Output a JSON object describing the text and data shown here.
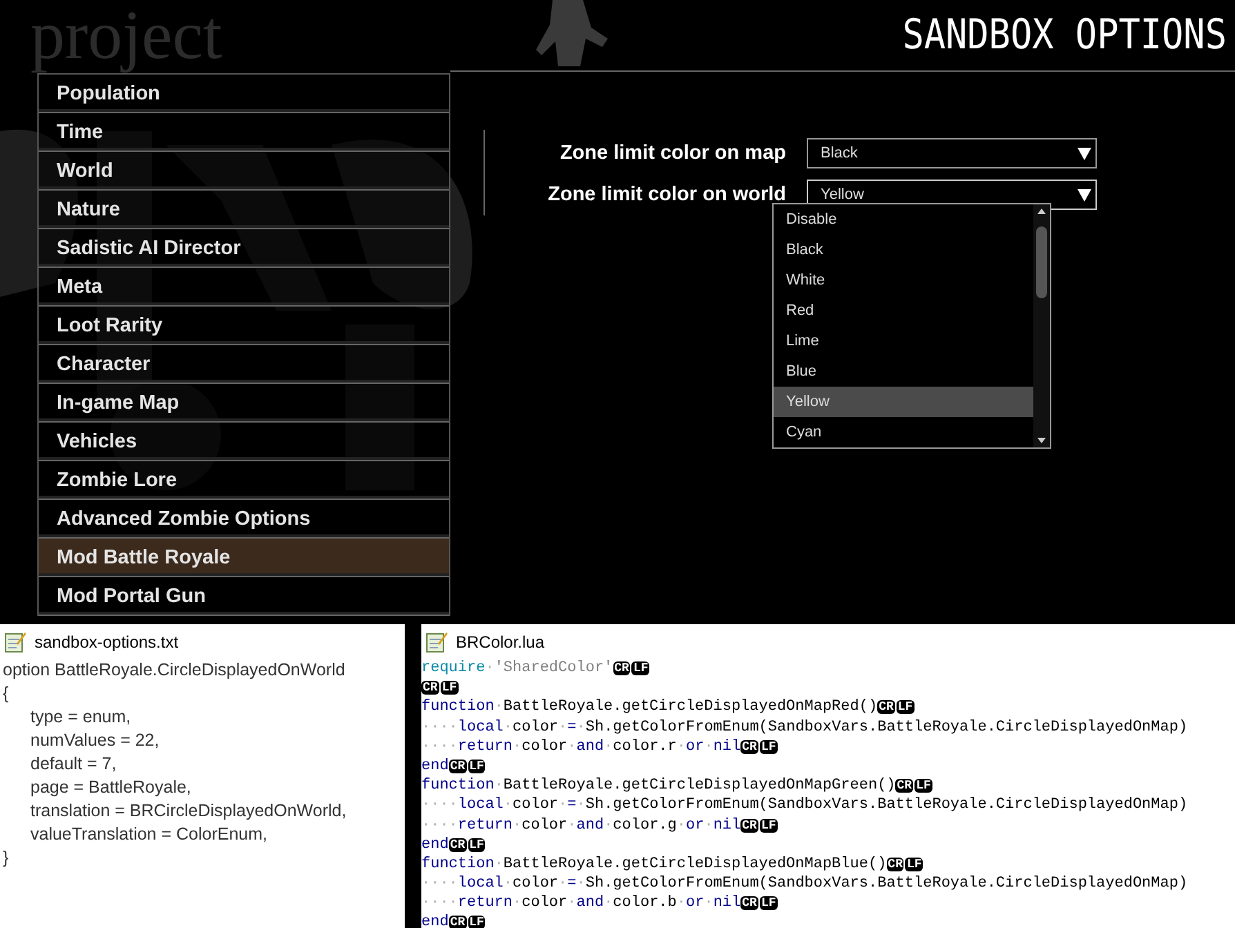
{
  "logo": {
    "text": "project"
  },
  "header": {
    "title": "SANDBOX OPTIONS"
  },
  "categories": [
    {
      "label": "Population",
      "selected": false
    },
    {
      "label": "Time",
      "selected": false
    },
    {
      "label": "World",
      "selected": false
    },
    {
      "label": "Nature",
      "selected": false
    },
    {
      "label": "Sadistic AI Director",
      "selected": false
    },
    {
      "label": "Meta",
      "selected": false
    },
    {
      "label": "Loot Rarity",
      "selected": false
    },
    {
      "label": "Character",
      "selected": false
    },
    {
      "label": "In-game Map",
      "selected": false
    },
    {
      "label": "Vehicles",
      "selected": false
    },
    {
      "label": "Zombie Lore",
      "selected": false
    },
    {
      "label": "Advanced Zombie Options",
      "selected": false
    },
    {
      "label": "Mod Battle Royale",
      "selected": true
    },
    {
      "label": "Mod Portal Gun",
      "selected": false
    }
  ],
  "settings": [
    {
      "label": "Zone limit color on map",
      "value": "Black",
      "expanded": false
    },
    {
      "label": "Zone limit color on world",
      "value": "Yellow",
      "expanded": true,
      "options": [
        {
          "label": "Disable",
          "selected": false
        },
        {
          "label": "Black",
          "selected": false
        },
        {
          "label": "White",
          "selected": false
        },
        {
          "label": "Red",
          "selected": false
        },
        {
          "label": "Lime",
          "selected": false
        },
        {
          "label": "Blue",
          "selected": false
        },
        {
          "label": "Yellow",
          "selected": true
        },
        {
          "label": "Cyan",
          "selected": false
        }
      ]
    }
  ],
  "text_file": {
    "title": "sandbox-options.txt",
    "header": "option BattleRoyale.CircleDisplayedOnWorld",
    "open": "{",
    "body": [
      "type = enum,",
      "numValues = 22,",
      "default = 7,",
      "page = BattleRoyale,",
      "translation = BRCircleDisplayedOnWorld,",
      "valueTranslation = ColorEnum,"
    ],
    "close": "}"
  },
  "code_file": {
    "title": "BRColor.lua",
    "lines": [
      [
        {
          "text": "require",
          "kind": "builtin"
        },
        {
          "text": "·",
          "kind": "ws"
        },
        {
          "text": "'SharedColor'",
          "kind": "str"
        },
        {
          "text": "CR",
          "kind": "eol"
        },
        {
          "text": "LF",
          "kind": "eol"
        }
      ],
      [
        {
          "text": "CR",
          "kind": "eol"
        },
        {
          "text": "LF",
          "kind": "eol"
        }
      ],
      [
        {
          "text": "function",
          "kind": "kw"
        },
        {
          "text": "·",
          "kind": "ws"
        },
        {
          "text": "BattleRoyale.getCircleDisplayedOnMapRed()",
          "kind": "id"
        },
        {
          "text": "CR",
          "kind": "eol"
        },
        {
          "text": "LF",
          "kind": "eol"
        }
      ],
      [
        {
          "text": "····",
          "kind": "ws"
        },
        {
          "text": "local",
          "kind": "kw"
        },
        {
          "text": "·",
          "kind": "ws"
        },
        {
          "text": "color",
          "kind": "id"
        },
        {
          "text": "·",
          "kind": "ws"
        },
        {
          "text": "=",
          "kind": "kw"
        },
        {
          "text": "·",
          "kind": "ws"
        },
        {
          "text": "Sh.getColorFromEnum(SandboxVars.BattleRoyale.CircleDisplayedOnMap)",
          "kind": "id"
        }
      ],
      [
        {
          "text": "····",
          "kind": "ws"
        },
        {
          "text": "return",
          "kind": "kw"
        },
        {
          "text": "·",
          "kind": "ws"
        },
        {
          "text": "color",
          "kind": "id"
        },
        {
          "text": "·",
          "kind": "ws"
        },
        {
          "text": "and",
          "kind": "kw"
        },
        {
          "text": "·",
          "kind": "ws"
        },
        {
          "text": "color.r",
          "kind": "id"
        },
        {
          "text": "·",
          "kind": "ws"
        },
        {
          "text": "or",
          "kind": "kw"
        },
        {
          "text": "·",
          "kind": "ws"
        },
        {
          "text": "nil",
          "kind": "kw"
        },
        {
          "text": "CR",
          "kind": "eol"
        },
        {
          "text": "LF",
          "kind": "eol"
        }
      ],
      [
        {
          "text": "end",
          "kind": "kw"
        },
        {
          "text": "CR",
          "kind": "eol"
        },
        {
          "text": "LF",
          "kind": "eol"
        }
      ],
      [
        {
          "text": "function",
          "kind": "kw"
        },
        {
          "text": "·",
          "kind": "ws"
        },
        {
          "text": "BattleRoyale.getCircleDisplayedOnMapGreen()",
          "kind": "id"
        },
        {
          "text": "CR",
          "kind": "eol"
        },
        {
          "text": "LF",
          "kind": "eol"
        }
      ],
      [
        {
          "text": "····",
          "kind": "ws"
        },
        {
          "text": "local",
          "kind": "kw"
        },
        {
          "text": "·",
          "kind": "ws"
        },
        {
          "text": "color",
          "kind": "id"
        },
        {
          "text": "·",
          "kind": "ws"
        },
        {
          "text": "=",
          "kind": "kw"
        },
        {
          "text": "·",
          "kind": "ws"
        },
        {
          "text": "Sh.getColorFromEnum(SandboxVars.BattleRoyale.CircleDisplayedOnMap)",
          "kind": "id"
        }
      ],
      [
        {
          "text": "····",
          "kind": "ws"
        },
        {
          "text": "return",
          "kind": "kw"
        },
        {
          "text": "·",
          "kind": "ws"
        },
        {
          "text": "color",
          "kind": "id"
        },
        {
          "text": "·",
          "kind": "ws"
        },
        {
          "text": "and",
          "kind": "kw"
        },
        {
          "text": "·",
          "kind": "ws"
        },
        {
          "text": "color.g",
          "kind": "id"
        },
        {
          "text": "·",
          "kind": "ws"
        },
        {
          "text": "or",
          "kind": "kw"
        },
        {
          "text": "·",
          "kind": "ws"
        },
        {
          "text": "nil",
          "kind": "kw"
        },
        {
          "text": "CR",
          "kind": "eol"
        },
        {
          "text": "LF",
          "kind": "eol"
        }
      ],
      [
        {
          "text": "end",
          "kind": "kw"
        },
        {
          "text": "CR",
          "kind": "eol"
        },
        {
          "text": "LF",
          "kind": "eol"
        }
      ],
      [
        {
          "text": "function",
          "kind": "kw"
        },
        {
          "text": "·",
          "kind": "ws"
        },
        {
          "text": "BattleRoyale.getCircleDisplayedOnMapBlue()",
          "kind": "id"
        },
        {
          "text": "CR",
          "kind": "eol"
        },
        {
          "text": "LF",
          "kind": "eol"
        }
      ],
      [
        {
          "text": "····",
          "kind": "ws"
        },
        {
          "text": "local",
          "kind": "kw"
        },
        {
          "text": "·",
          "kind": "ws"
        },
        {
          "text": "color",
          "kind": "id"
        },
        {
          "text": "·",
          "kind": "ws"
        },
        {
          "text": "=",
          "kind": "kw"
        },
        {
          "text": "·",
          "kind": "ws"
        },
        {
          "text": "Sh.getColorFromEnum(SandboxVars.BattleRoyale.CircleDisplayedOnMap)",
          "kind": "id"
        }
      ],
      [
        {
          "text": "····",
          "kind": "ws"
        },
        {
          "text": "return",
          "kind": "kw"
        },
        {
          "text": "·",
          "kind": "ws"
        },
        {
          "text": "color",
          "kind": "id"
        },
        {
          "text": "·",
          "kind": "ws"
        },
        {
          "text": "and",
          "kind": "kw"
        },
        {
          "text": "·",
          "kind": "ws"
        },
        {
          "text": "color.b",
          "kind": "id"
        },
        {
          "text": "·",
          "kind": "ws"
        },
        {
          "text": "or",
          "kind": "kw"
        },
        {
          "text": "·",
          "kind": "ws"
        },
        {
          "text": "nil",
          "kind": "kw"
        },
        {
          "text": "CR",
          "kind": "eol"
        },
        {
          "text": "LF",
          "kind": "eol"
        }
      ],
      [
        {
          "text": "end",
          "kind": "kw"
        },
        {
          "text": "CR",
          "kind": "eol"
        },
        {
          "text": "LF",
          "kind": "eol"
        }
      ]
    ]
  }
}
